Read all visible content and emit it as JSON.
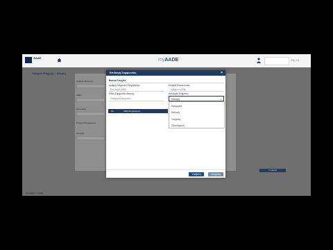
{
  "app": {
    "logo_text": "ΑΑΔΕ",
    "brand_prefix": "my",
    "brand_name": "AADE",
    "logout_label": "Εξ. Ι.Σ."
  },
  "page": {
    "subtitle": "Στοιχεία Επιχείρ. - Αίτηση",
    "bg_labels": [
      "Αριθμός Μητρώου",
      "ΑΦΜ",
      "Επωνυμία",
      "Στοιχεία Επιχείρησης",
      "Επιλογή"
    ],
    "bg_button": "Υποβολή",
    "footer": "Copyright © ΑΑΔΕ"
  },
  "modal": {
    "title": "Επιλογή Συμφωνίας",
    "section_title": "Βασικά Στοιχεία",
    "left_label_1": "Αριθμός Μητρώου Επιχείρησης",
    "left_value_1": "Επωνυμία ΑΦΜ",
    "left_label_2": "Είδος Συμφωνίας Αίτησης",
    "left_value_2": "Κατηγορία αιτήματος",
    "right_label_1": "Στοιχεία Επικοινωνίας",
    "right_value_1": "Τηλέφωνο ΑΦΜ",
    "right_label_2": "Αιτιολογία Αιτήματος",
    "select_value": "Επιλογή",
    "options": [
      "Κατηγορία",
      "Επιλογή",
      "Υποβολή",
      "Ολοκλήρωση"
    ],
    "row_code": "ΚΑ",
    "row_text": "ΑΦΜ Επιχείρησης",
    "ok_label": "Υποβολή",
    "cancel_label": "Ακύρωση"
  }
}
